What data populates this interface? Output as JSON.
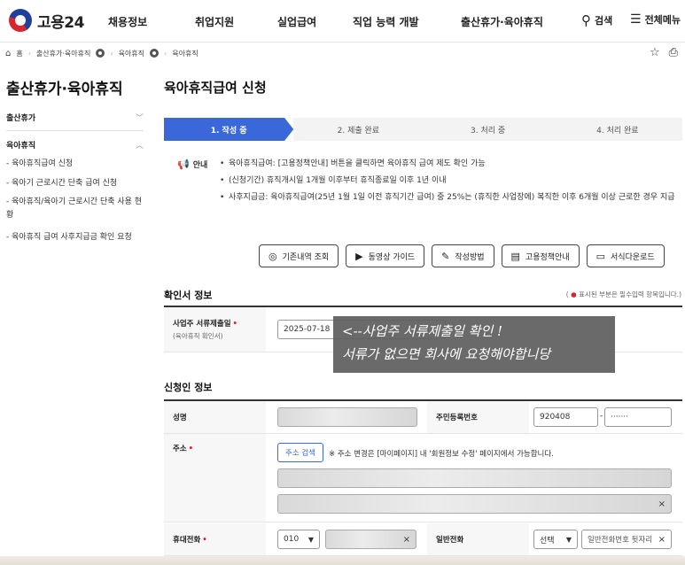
{
  "brand": {
    "name": "고용24"
  },
  "nav": {
    "items": [
      "채용정보",
      "취업지원",
      "실업급여",
      "직업 능력 개발",
      "출산휴가·육아휴직"
    ],
    "search": "검색",
    "menu": "전체메뉴"
  },
  "breadcrumb": {
    "home": "홈",
    "level1": "출산휴가·육아휴직",
    "level2": "육아휴직",
    "level3": "육아휴직"
  },
  "sidebar": {
    "title": "출산휴가·육아휴직",
    "groups": [
      {
        "label": "출산휴가",
        "chevron": "﹀"
      },
      {
        "label": "육아휴직",
        "chevron": "︿"
      }
    ],
    "items": [
      "- 육아휴직급여 신청",
      "- 육아기 근로시간 단축 급여 신청",
      "- 육아휴직/육아기 근로시간 단축 사용 현황",
      "- 육아휴직 급여 사후지급금 확인 요청"
    ]
  },
  "page": {
    "title": "육아휴직급여 신청"
  },
  "steps": [
    {
      "label": "1. 작성 중",
      "active": true
    },
    {
      "label": "2. 제출 완료",
      "active": false
    },
    {
      "label": "3. 처리 중",
      "active": false
    },
    {
      "label": "4. 처리 완료",
      "active": false
    }
  ],
  "notice": {
    "head": "안내",
    "items": [
      "육아휴직급여: [고용정책안내] 버튼을 클릭하면 육아휴직 급여 제도 확인 가능",
      "(신청기간) 휴직개시일 1개월 이후부터 휴직종료일 이후 1년 이내",
      "사후지급금: 육아휴직급여(25년 1월 1일 이전 휴직기간 급여) 중 25%는 (휴직한 사업장에) 복직한 이후 6개월 이상 근로한 경우 지급"
    ]
  },
  "tools": [
    {
      "label": "기존내역 조회",
      "icon": "search-icon",
      "glyph": "◎"
    },
    {
      "label": "동영상 가이드",
      "icon": "play-icon",
      "glyph": "▶"
    },
    {
      "label": "작성방법",
      "icon": "pencil-icon",
      "glyph": "✎"
    },
    {
      "label": "고용정책안내",
      "icon": "document-icon",
      "glyph": "▤"
    },
    {
      "label": "서식다운로드",
      "icon": "monitor-icon",
      "glyph": "▭"
    }
  ],
  "confirm": {
    "title": "확인서 정보",
    "required_note": "표시된 부분은 필수입력 항목입니다.",
    "employer_label": "사업주 서류제출일",
    "employer_sub": "(육아휴직 확인서)",
    "employer_date": "2025-07-18"
  },
  "overlay": {
    "line1": "<--사업주 서류제출일 확인 !",
    "line2": "서류가 없으면 회사에 요청해야합니당"
  },
  "applicant": {
    "title": "신청인 정보",
    "name_label": "성명",
    "rrn_label": "주민등록번호",
    "rrn_front": "920408",
    "rrn_back": "·······",
    "address_label": "주소",
    "address_button": "주소 검색",
    "address_note": "※ 주소 변경은 [마이페이지] 내 '회원정보 수정' 페이지에서 가능합니다.",
    "mobile_label": "휴대전화",
    "mobile_prefix": "010",
    "phone_label": "일반전화",
    "phone_select": "선택",
    "phone_placeholder": "일반전화번호 뒷자리"
  },
  "colors": {
    "accent": "#3a68d8",
    "required": "#d8262f",
    "notice_icon": "#1c8c4a"
  }
}
